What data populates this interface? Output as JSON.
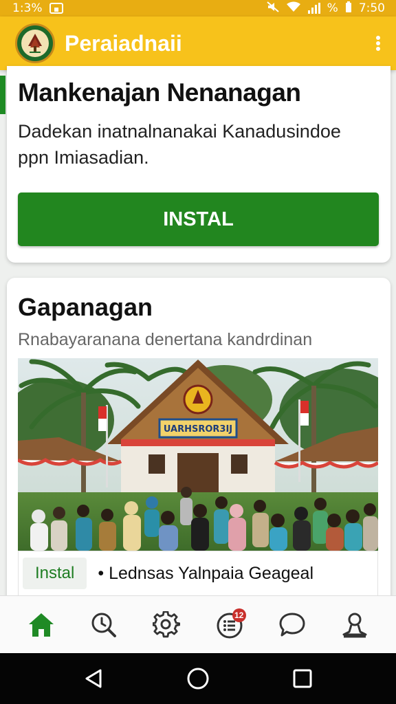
{
  "status_bar": {
    "battery_text": "1:3%",
    "right_text": "%",
    "time": "7:50"
  },
  "app_bar": {
    "title": "Peraiadnaii",
    "menu_icon": "kebab-menu-icon",
    "logo_icon": "tree-emblem-icon"
  },
  "card_main": {
    "title": "Mankenajan Nenanagan",
    "description": "Dadekan inatnalnanakai Kanadusindoe ppn Imiasadian.",
    "install_label": "INSTAL"
  },
  "card_feature": {
    "title": "Gapanagan",
    "subtitle": "Rnabayaranana denertana kandrdinan",
    "photo_sign_text": "UARHSROR3IJ",
    "chip_label": "Instal",
    "caption": "• Lednsas Yalnpaia Geageal"
  },
  "bottom_nav": {
    "items": [
      {
        "icon": "home-icon",
        "active": true
      },
      {
        "icon": "search-clock-icon",
        "active": false
      },
      {
        "icon": "settings-icon",
        "active": false
      },
      {
        "icon": "list-icon",
        "active": false,
        "badge": "12"
      },
      {
        "icon": "chat-icon",
        "active": false
      },
      {
        "icon": "profile-icon",
        "active": false
      }
    ]
  },
  "system_nav": {
    "items": [
      "back-icon",
      "home-circle-icon",
      "recents-icon"
    ]
  },
  "colors": {
    "app_bar": "#f7c21b",
    "status_bar": "#e8ad12",
    "primary_green": "#22861f",
    "badge_red": "#c9302c"
  }
}
